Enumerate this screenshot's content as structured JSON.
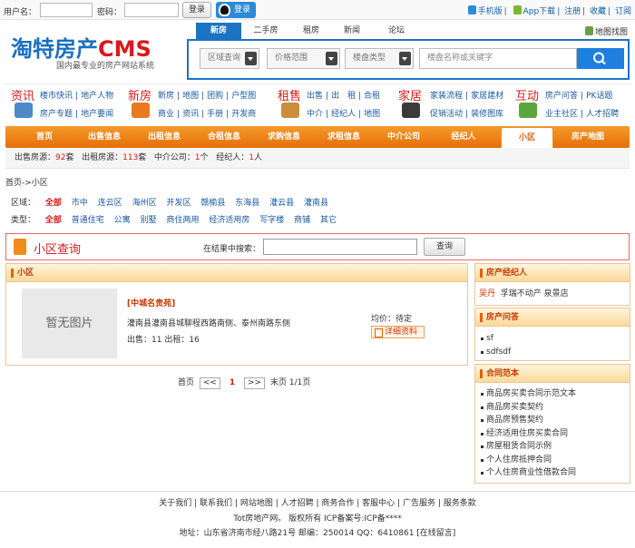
{
  "topbar": {
    "username_label": "用户名：",
    "password_label": "密码：",
    "login_btn": "登录",
    "qq_login": "登录",
    "links": [
      "手机版",
      "App下载",
      "注册",
      "收藏",
      "订阅"
    ]
  },
  "header": {
    "logo_main": "淘特房产",
    "logo_cms": "CMS",
    "slogan": "国内最专业的房产网站系统",
    "map_link": "地图找图",
    "tabs": [
      "新房",
      "二手房",
      "租房",
      "新闻",
      "论坛"
    ],
    "selects": [
      "区域查询",
      "价格范围",
      "楼盘类型"
    ],
    "keyword_placeholder": "楼盘名称或关键字"
  },
  "subnav": {
    "zixun": {
      "title": "资讯",
      "row1": [
        "楼市快讯",
        "地产人物"
      ],
      "row2": [
        "房产专题",
        "地产要闻"
      ]
    },
    "xinfang": {
      "title": "新房",
      "row1": [
        "新房",
        "地图",
        "团购",
        "户型图"
      ],
      "row2": [
        "商业",
        "资讯",
        "手册",
        "开发商"
      ]
    },
    "zushou": {
      "title": "租售",
      "row1": [
        "出售",
        "出",
        "租",
        "合租"
      ],
      "row2": [
        "中介",
        "经纪人",
        "地图"
      ]
    },
    "jiaju": {
      "title": "家居",
      "row1": [
        "家装流程",
        "家居建材"
      ],
      "row2": [
        "促销活动",
        "装修图库"
      ]
    },
    "hudong": {
      "title": "互动",
      "row1": [
        "房产问答",
        "PK话题"
      ],
      "row2": [
        "业主社区",
        "人才招聘"
      ]
    }
  },
  "mainnav": [
    "首页",
    "出售信息",
    "出租信息",
    "合租信息",
    "求购信息",
    "求租信息",
    "中介公司",
    "经纪人",
    "小区",
    "房产地图"
  ],
  "stats": {
    "sale_label": "出售房源：",
    "sale_count": "92",
    "unit": "套",
    "rent_label": "出租房源：",
    "rent_count": "113",
    "agency_label": "中介公司：",
    "agency_count": "1",
    "agency_unit": "个",
    "agent_label": "经纪人：",
    "agent_count": "1",
    "agent_unit": "人"
  },
  "breadcrumb": "首页->小区",
  "filters": {
    "area_label": "区域：",
    "areas": [
      "全部",
      "市中",
      "连云区",
      "海州区",
      "开发区",
      "赣榆县",
      "东海县",
      "灌云县",
      "灌南县"
    ],
    "type_label": "类型：",
    "types": [
      "全部",
      "普通住宅",
      "公寓",
      "别墅",
      "商住两用",
      "经济适用房",
      "写字楼",
      "商铺",
      "其它"
    ]
  },
  "query": {
    "title": "小区查询",
    "search_label": "在结果中搜索：",
    "button": "查询"
  },
  "list": {
    "header": "小区",
    "items": [
      {
        "image_text": "暂无图片",
        "title": "[中城名贵苑]",
        "address": "灌南县灌南县城聊程西路南侧、泰州南路东侧",
        "sale_label": "出售：",
        "sale": "11",
        "rent_label": "出租：",
        "rent": "16",
        "price_label": "均价：",
        "price": "待定",
        "detail": "详细资料"
      }
    ]
  },
  "pager": {
    "first": "首页",
    "prev": "<<",
    "current": "1",
    "next": ">>",
    "last": "末页",
    "info": "1/1页"
  },
  "side": {
    "agents": {
      "title": "房产经纪人",
      "name": "吴丹",
      "company": "孚瑞不动产  泉景店"
    },
    "qa": {
      "title": "房产问答",
      "items": [
        "sf",
        "sdfsdf"
      ]
    },
    "contracts": {
      "title": "合同范本",
      "items": [
        "商品房买卖合同示范文本",
        "商品房买卖契约",
        "商品房预售契约",
        "经济适用住房买卖合同",
        "房屋租赁合同示例",
        "个人住房抵押合同",
        "个人住房商业性借款合同"
      ]
    }
  },
  "footer": {
    "links": [
      "关于我们",
      "联系我们",
      "网站地图",
      "人才招聘",
      "商务合作",
      "客服中心",
      "广告服务",
      "服务条款"
    ],
    "copyright": "Tot房地产网。 版权所有 ICP备案号:ICP备****",
    "address": "地址：山东省济南市经八路21号 邮编：250014 QQ：6410861 [在线留言]"
  },
  "colors": {
    "brand_blue": "#1b73c3",
    "accent_orange": "#e56f08",
    "accent_red": "#d51c1c"
  }
}
